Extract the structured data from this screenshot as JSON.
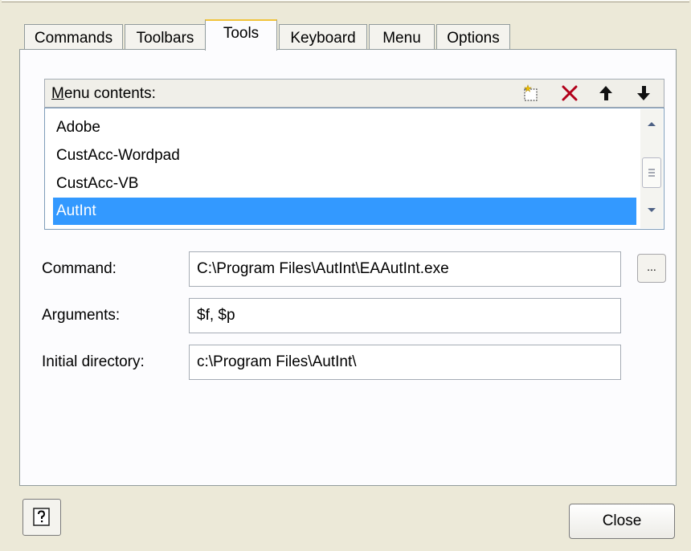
{
  "tabs": [
    {
      "label": "Commands",
      "active": false
    },
    {
      "label": "Toolbars",
      "active": false
    },
    {
      "label": "Tools",
      "active": true
    },
    {
      "label": "Keyboard",
      "active": false
    },
    {
      "label": "Menu",
      "active": false
    },
    {
      "label": "Options",
      "active": false
    }
  ],
  "menu_contents": {
    "label_accel": "M",
    "label_rest": "enu contents:",
    "toolbar_icons": [
      "new-item-icon",
      "delete-icon",
      "move-up-icon",
      "move-down-icon"
    ],
    "items": [
      "Adobe",
      "CustAcc-Wordpad",
      "CustAcc-VB",
      "AutInt"
    ],
    "selected_index": 3
  },
  "fields": {
    "command": {
      "label": "Command:",
      "value": "C:\\Program Files\\AutInt\\EAAutInt.exe"
    },
    "arguments": {
      "label": "Arguments:",
      "value": "$f, $p"
    },
    "initial_directory": {
      "label": "Initial directory:",
      "value": "c:\\Program Files\\AutInt\\"
    }
  },
  "browse_button_label": "...",
  "close_button_label": "Close",
  "colors": {
    "selection": "#3399ff",
    "dialog_bg": "#ece9d8",
    "active_tab_accent": "#f1c33b"
  }
}
